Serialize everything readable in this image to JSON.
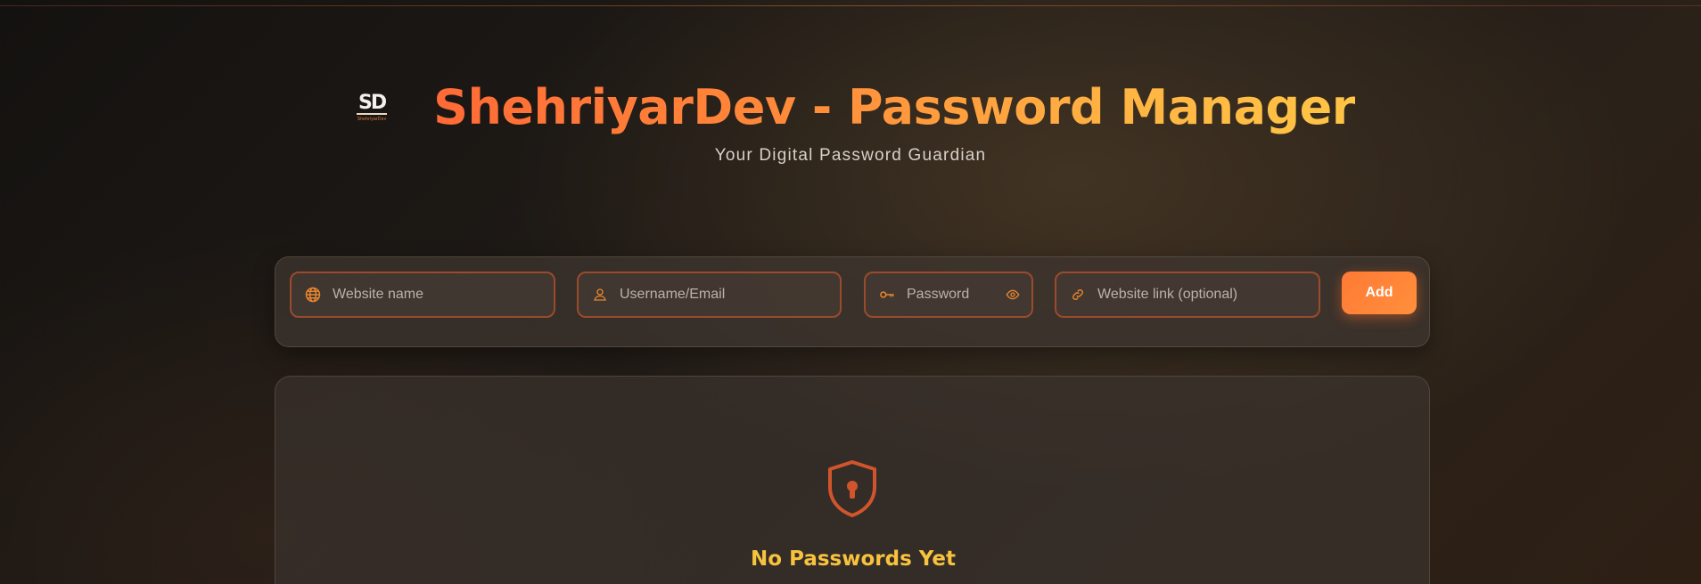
{
  "header": {
    "logo_text": "ShehriyarDev",
    "logo_mark": "SD",
    "title": "ShehriyarDev - Password Manager",
    "subtitle": "Your Digital Password Guardian"
  },
  "form": {
    "website_name": {
      "placeholder": "Website name",
      "value": "",
      "icon": "globe-icon"
    },
    "username": {
      "placeholder": "Username/Email",
      "value": "",
      "icon": "user-icon"
    },
    "password": {
      "placeholder": "Password",
      "value": "",
      "icon": "key-icon",
      "toggle_icon": "eye-icon"
    },
    "website_link": {
      "placeholder": "Website link (optional)",
      "value": "",
      "icon": "link-icon"
    },
    "add_label": "Add"
  },
  "empty_state": {
    "icon": "shield-lock-icon",
    "title": "No Passwords Yet"
  },
  "colors": {
    "accent": "#ff7a35",
    "accent_yellow": "#f7c23e",
    "input_border": "#9a4b2c"
  }
}
